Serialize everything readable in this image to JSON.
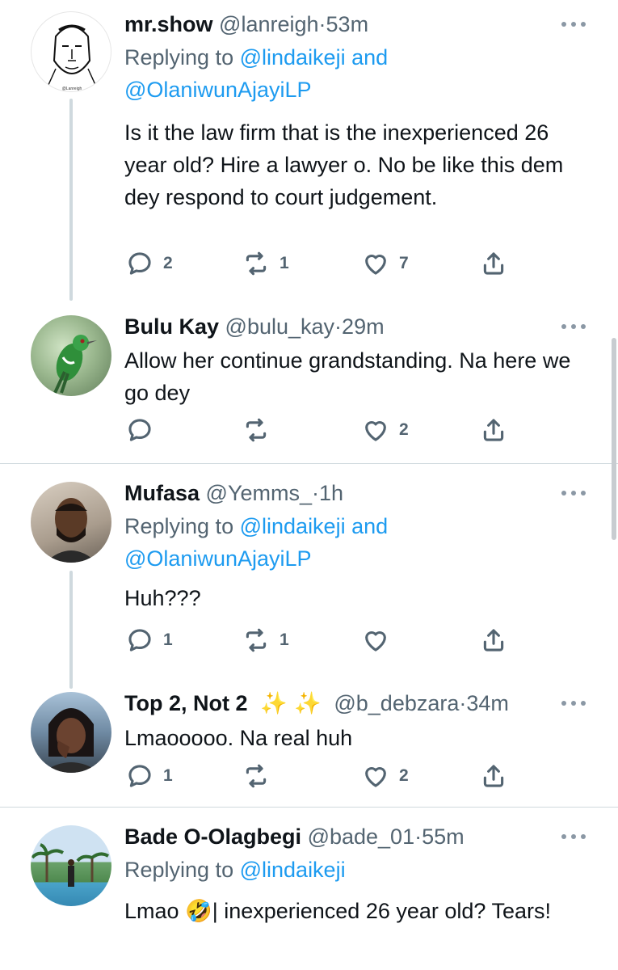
{
  "tweets": [
    {
      "name": "mr.show",
      "handle": "@lanreigh",
      "dot": "·",
      "time": "53m",
      "replying_prefix": "Replying to",
      "replying_line1": "@lindaikeji and",
      "replying_line2": "@OlaniwunAjayiLP",
      "text": "Is it the law firm that is the inexperienced 26 year old? Hire a lawyer o. No be like this dem dey respond to court judgement.",
      "replies": "2",
      "retweets": "1",
      "likes": "7",
      "avatar": "sketch-avatar"
    },
    {
      "name": "Bulu Kay",
      "handle": "@bulu_kay",
      "dot": "·",
      "time": "29m",
      "text": "Allow her continue grandstanding. Na here we go dey",
      "replies": "",
      "retweets": "",
      "likes": "2",
      "avatar": "bird-avatar"
    },
    {
      "name": "Mufasa",
      "handle": "@Yemms_",
      "dot": "·",
      "time": "1h",
      "replying_prefix": "Replying to",
      "replying_line1": "@lindaikeji and",
      "replying_line2": "@OlaniwunAjayiLP",
      "text": "Huh???",
      "replies": "1",
      "retweets": "1",
      "likes": "",
      "avatar": "man-avatar"
    },
    {
      "name": "Top 2, Not 2",
      "name_emoji": "✨ ✨",
      "handle": "@b_debzara",
      "dot": "·",
      "time": "34m",
      "text": "Lmaooooo. Na real huh",
      "replies": "1",
      "retweets": "",
      "likes": "2",
      "avatar": "woman-avatar"
    },
    {
      "name": "Bade O-Olagbegi",
      "handle": "@bade_01",
      "dot": "·",
      "time": "55m",
      "replying_prefix": "Replying to",
      "replying_line1": "@lindaikeji",
      "text_start": "Lmao",
      "text_emoji": "🤣",
      "text_end": "| inexperienced 26 year old? Tears!",
      "avatar": "beach-avatar"
    }
  ],
  "colors": {
    "accent": "#1d9bf0",
    "secondary_text": "#536471",
    "primary_text": "#0f1419",
    "divider": "#cfd9de"
  }
}
